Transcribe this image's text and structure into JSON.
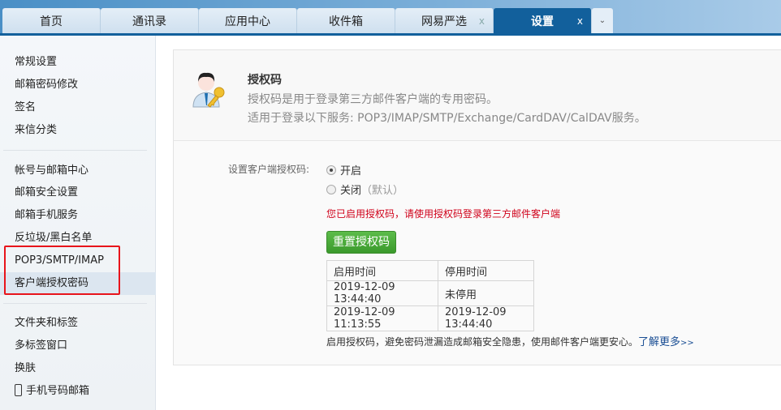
{
  "tabs": [
    {
      "label": "首页"
    },
    {
      "label": "通讯录"
    },
    {
      "label": "应用中心"
    },
    {
      "label": "收件箱"
    },
    {
      "label": "网易严选",
      "close": "x"
    },
    {
      "label": "设置",
      "close": "x"
    }
  ],
  "tabs_more": "⌄",
  "sidebar": {
    "items": [
      "常规设置",
      "邮箱密码修改",
      "签名",
      "来信分类",
      "帐号与邮箱中心",
      "邮箱安全设置",
      "邮箱手机服务",
      "反垃圾/黑白名单",
      "POP3/SMTP/IMAP",
      "客户端授权密码",
      "文件夹和标签",
      "多标签窗口",
      "换肤",
      "手机号码邮箱"
    ]
  },
  "header": {
    "title": "授权码",
    "desc1": "授权码是用于登录第三方邮件客户端的专用密码。",
    "desc2": "适用于登录以下服务: POP3/IMAP/SMTP/Exchange/CardDAV/CalDAV服务。"
  },
  "form": {
    "label": "设置客户端授权码:",
    "opt_on": "开启",
    "opt_off": "关闭",
    "opt_off_note": "（默认）",
    "selected": "开启",
    "warning": "您已启用授权码，请使用授权码登录第三方邮件客户端",
    "reset_button": "重置授权码"
  },
  "table": {
    "headers": [
      "启用时间",
      "停用时间"
    ],
    "rows": [
      [
        "2019-12-09 13:44:40",
        "未停用"
      ],
      [
        "2019-12-09 11:13:55",
        "2019-12-09 13:44:40"
      ]
    ]
  },
  "footer": {
    "text": "启用授权码，避免密码泄漏造成邮箱安全隐患，使用邮件客户端更安心。",
    "link": "了解更多",
    "link_suffix": ">>"
  }
}
